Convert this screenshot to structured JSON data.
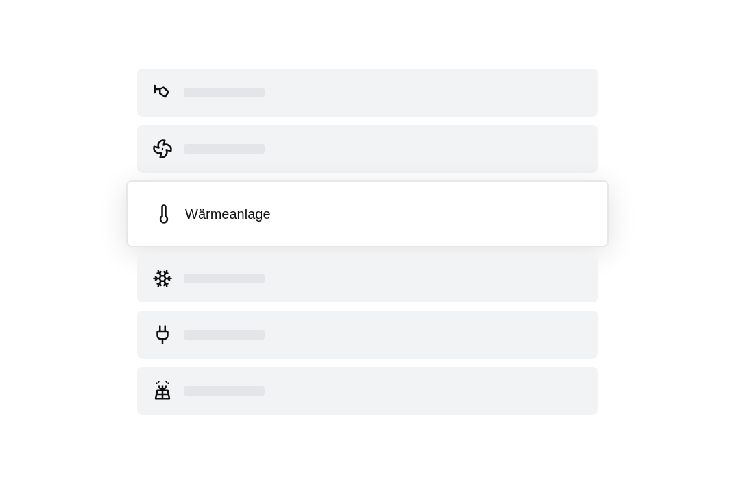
{
  "items": [
    {
      "selected": false
    },
    {
      "selected": false
    },
    {
      "label": "Wärmeanlage",
      "selected": true
    },
    {
      "selected": false
    },
    {
      "selected": false
    },
    {
      "selected": false
    }
  ]
}
